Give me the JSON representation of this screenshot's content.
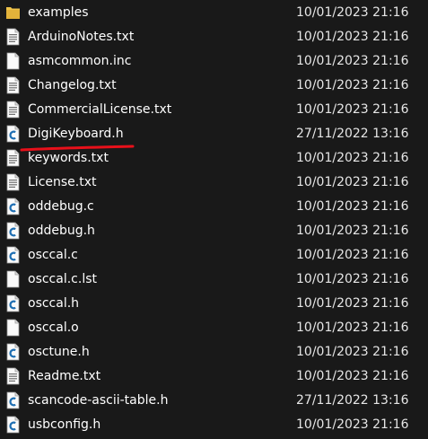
{
  "files": [
    {
      "name": "examples",
      "date": "10/01/2023 21:16",
      "icon": "folder-icon"
    },
    {
      "name": "ArduinoNotes.txt",
      "date": "10/01/2023 21:16",
      "icon": "text-file-icon"
    },
    {
      "name": "asmcommon.inc",
      "date": "10/01/2023 21:16",
      "icon": "blank-file-icon"
    },
    {
      "name": "Changelog.txt",
      "date": "10/01/2023 21:16",
      "icon": "text-file-icon"
    },
    {
      "name": "CommercialLicense.txt",
      "date": "10/01/2023 21:16",
      "icon": "text-file-icon"
    },
    {
      "name": "DigiKeyboard.h",
      "date": "27/11/2022 13:16",
      "icon": "c-file-icon"
    },
    {
      "name": "keywords.txt",
      "date": "10/01/2023 21:16",
      "icon": "text-file-icon"
    },
    {
      "name": "License.txt",
      "date": "10/01/2023 21:16",
      "icon": "text-file-icon"
    },
    {
      "name": "oddebug.c",
      "date": "10/01/2023 21:16",
      "icon": "c-file-icon"
    },
    {
      "name": "oddebug.h",
      "date": "10/01/2023 21:16",
      "icon": "c-file-icon"
    },
    {
      "name": "osccal.c",
      "date": "10/01/2023 21:16",
      "icon": "c-file-icon"
    },
    {
      "name": "osccal.c.lst",
      "date": "10/01/2023 21:16",
      "icon": "blank-file-icon"
    },
    {
      "name": "osccal.h",
      "date": "10/01/2023 21:16",
      "icon": "c-file-icon"
    },
    {
      "name": "osccal.o",
      "date": "10/01/2023 21:16",
      "icon": "blank-file-icon"
    },
    {
      "name": "osctune.h",
      "date": "10/01/2023 21:16",
      "icon": "c-file-icon"
    },
    {
      "name": "Readme.txt",
      "date": "10/01/2023 21:16",
      "icon": "text-file-icon"
    },
    {
      "name": "scancode-ascii-table.h",
      "date": "27/11/2022 13:16",
      "icon": "c-file-icon"
    },
    {
      "name": "usbconfig.h",
      "date": "10/01/2023 21:16",
      "icon": "c-file-icon"
    }
  ],
  "colors": {
    "background": "#191919",
    "text": "#ffffff",
    "folder": "#f0c44a",
    "underline": "#e8101a"
  }
}
